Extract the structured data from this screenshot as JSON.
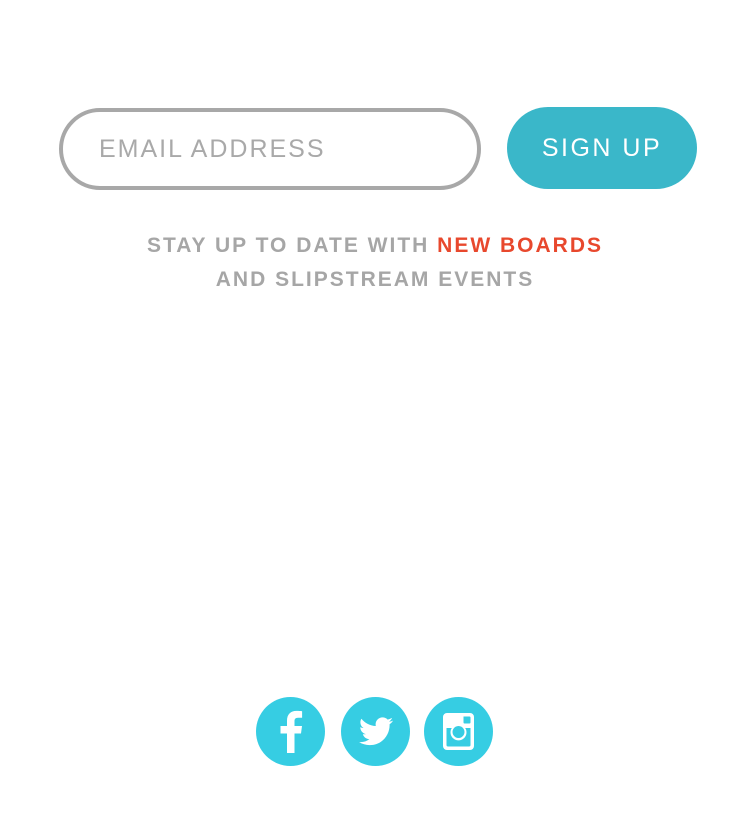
{
  "signup": {
    "email_placeholder": "EMAIL ADDRESS",
    "email_value": "",
    "button_label": "SIGN UP"
  },
  "tagline": {
    "line1_prefix": "STAY UP TO DATE WITH ",
    "line1_highlight": "NEW BOARDS",
    "line2": "AND SLIPSTREAM EVENTS"
  },
  "social": {
    "icons": [
      "facebook-icon",
      "twitter-icon",
      "instagram-icon"
    ]
  },
  "colors": {
    "accent": "#3ab7c9",
    "social": "#36cde3",
    "highlight": "#e8482d",
    "muted_text": "#a6a6a6",
    "field_border": "#a8a8a8"
  }
}
